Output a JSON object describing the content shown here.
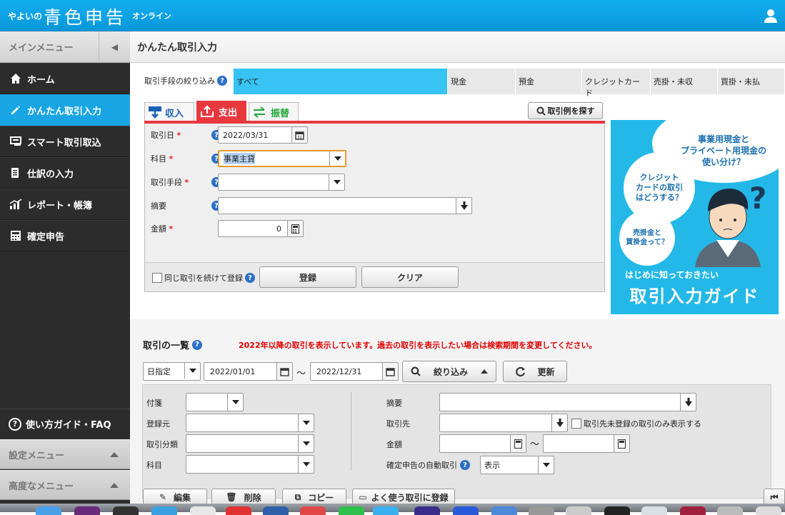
{
  "app": {
    "brand_small": "やよいの",
    "brand_big": "青色申告",
    "brand_sub": "オンライン"
  },
  "sidebar": {
    "header": "メインメニュー",
    "items": [
      {
        "label": "ホーム",
        "icon": "home-icon"
      },
      {
        "label": "かんたん取引入力",
        "icon": "pencil-icon",
        "active": true
      },
      {
        "label": "スマート取引取込",
        "icon": "import-icon"
      },
      {
        "label": "仕訳の入力",
        "icon": "journal-icon"
      },
      {
        "label": "レポート・帳簿",
        "icon": "chart-icon"
      },
      {
        "label": "確定申告",
        "icon": "calculator-icon"
      }
    ],
    "guide": "使い方ガイド・FAQ",
    "settings": "設定メニュー",
    "advanced": "高度なメニュー"
  },
  "page": {
    "title": "かんたん取引入力"
  },
  "payment": {
    "label": "取引手段の絞り込み",
    "tabs": [
      "すべて",
      "現金",
      "預金",
      "クレジットカード",
      "売掛・未収",
      "買掛・未払"
    ],
    "selected": "すべて"
  },
  "form": {
    "tabs": {
      "income": "収入",
      "expense": "支出",
      "transfer": "振替"
    },
    "search_example": "取引例を探す",
    "date_label": "取引日",
    "date_value": "2022/03/31",
    "account_label": "科目",
    "account_value": "事業主貸",
    "method_label": "取引手段",
    "summary_label": "摘要",
    "amount_label": "金額",
    "amount_value": "0",
    "required": "*",
    "continue_label": "同じ取引を続けて登録",
    "register": "登録",
    "clear": "クリア"
  },
  "banner": {
    "bubble1": "事業用現金と\nプライベート用現金の\n使い分け？",
    "bubble2": "クレジット\nカードの取引\nはどうする？",
    "bubble3": "売掛金と\n買掛金って？",
    "subtitle": "はじめに知っておきたい",
    "title": "取引入力ガイド"
  },
  "list": {
    "title": "取引の一覧",
    "warning": "2022年以降の取引を表示しています。過去の取引を表示したい場合は検索期間を変更してください。",
    "period_type": "日指定",
    "date_from": "2022/01/01",
    "tilde": "〜",
    "date_to": "2022/12/31",
    "filter": "絞り込み",
    "refresh": "更新",
    "filters": {
      "tag": "付箋",
      "source": "登録元",
      "category": "取引分類",
      "account": "科目",
      "summary": "摘要",
      "partner": "取引先",
      "partner_only": "取引先未登録の取引のみ表示する",
      "amount": "金額",
      "auto": "確定申告の自動取引",
      "auto_value": "表示"
    },
    "actions": {
      "edit": "編集",
      "delete": "削除",
      "copy": "コピー",
      "favorite": "よく使う取引に登録"
    }
  }
}
